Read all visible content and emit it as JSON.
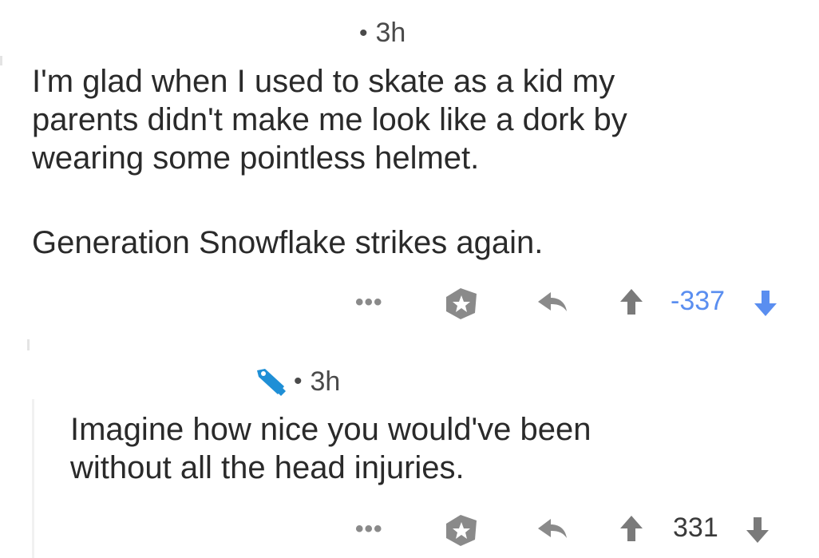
{
  "colors": {
    "text": "#2a2a2a",
    "meta": "#4a4a4a",
    "icon": "#8a8a8a",
    "downvote": "#5a8ef0",
    "mod_icon": "#1f8fd6"
  },
  "comments": [
    {
      "timestamp": "3h",
      "separator": "•",
      "paragraphs": [
        "I'm glad when I used to skate as a kid my",
        "parents didn't make me look like a dork by",
        "wearing some pointless helmet."
      ],
      "paragraph2": "Generation Snowflake strikes again.",
      "actions": {
        "more_label": "•••",
        "score": "-337",
        "vote_state": "downvoted"
      }
    },
    {
      "timestamp": "3h",
      "separator": "•",
      "author_icon": "mod-icon",
      "paragraphs": [
        "Imagine how nice you would've been",
        "without all the head injuries."
      ],
      "actions": {
        "more_label": "•••",
        "score": "331",
        "vote_state": "none"
      }
    }
  ]
}
